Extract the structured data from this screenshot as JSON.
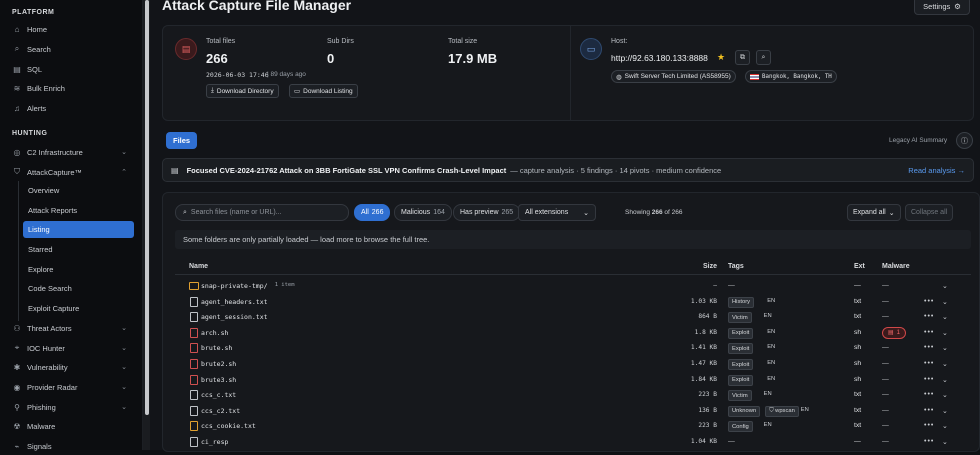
{
  "sidebar": {
    "platform_label": "PLATFORM",
    "platform_items": [
      {
        "label": "Home",
        "icon": "home-icon"
      },
      {
        "label": "Search",
        "icon": "search-icon"
      },
      {
        "label": "SQL",
        "icon": "database-icon"
      },
      {
        "label": "Bulk Enrich",
        "icon": "layers-icon"
      },
      {
        "label": "Alerts",
        "icon": "bell-icon"
      }
    ],
    "hunting_label": "HUNTING",
    "hunting_items": [
      {
        "label": "C2 Infrastructure",
        "icon": "target-icon"
      },
      {
        "label": "AttackCapture™",
        "icon": "shield-icon"
      }
    ],
    "attackcapture_sub": [
      "Overview",
      "Attack Reports",
      "Listing",
      "Starred",
      "Explore",
      "Code Search",
      "Exploit Capture"
    ],
    "active_sub": "Listing",
    "more_items": [
      {
        "label": "Threat Actors",
        "icon": "users-icon"
      },
      {
        "label": "IOC Hunter",
        "icon": "crosshair-icon"
      },
      {
        "label": "Vulnerability",
        "icon": "bug-icon"
      },
      {
        "label": "Provider Radar",
        "icon": "radar-icon"
      },
      {
        "label": "Phishing",
        "icon": "hook-icon"
      },
      {
        "label": "Malware",
        "icon": "virus-icon"
      },
      {
        "label": "Signals",
        "icon": "signal-icon"
      }
    ]
  },
  "page": {
    "title": "Attack Capture File Manager",
    "settings_label": "Settings"
  },
  "summary": {
    "total_files_label": "Total files",
    "total_files": "266",
    "subdirs_label": "Sub Dirs",
    "subdirs": "0",
    "total_size_label": "Total size",
    "total_size": "17.9 MB",
    "timestamp": "2026-06-03 17:46",
    "ago": "| 89 days ago",
    "download_directory": "Download Directory",
    "download_listing": "Download Listing",
    "host_label": "Host:",
    "host": "http://92.63.180.133:8888",
    "provider": "Swift Server Tech Limited (AS58955)",
    "location": "Bangkok, Bangkok, TH"
  },
  "tabs": {
    "files": "Files",
    "legacy": "Legacy AI Summary"
  },
  "banner": {
    "headline": "Focused CVE-2024-21762 Attack on 3BB FortiGate SSL VPN Confirms Crash-Level Impact",
    "meta": "— capture analysis · 5 findings · 14 pivots · medium confidence",
    "link": "Read analysis →"
  },
  "toolbar": {
    "search_placeholder": "Search files (name or URL)...",
    "filters": [
      {
        "label": "All",
        "count": "266"
      },
      {
        "label": "Malicious",
        "count": "164"
      },
      {
        "label": "Has preview",
        "count": "265"
      }
    ],
    "extensions": "All extensions",
    "showing": "Showing",
    "showing_count": "266",
    "showing_total": "of 266",
    "expand_all": "Expand all",
    "collapse_all": "Collapse all"
  },
  "notice": "Some folders are only partially loaded — load more to browse the full tree.",
  "table": {
    "headers": {
      "name": "Name",
      "size": "Size",
      "tags": "Tags",
      "ext": "Ext",
      "malware": "Malware"
    },
    "rows": [
      {
        "name": "snap-private-tmp/",
        "folder": true,
        "extra": "1 item",
        "size": "—",
        "tags": [],
        "lang": "",
        "ext": "—",
        "malware": "—"
      },
      {
        "name": "agent_headers.txt",
        "size": "1.03 KB",
        "tags": [
          "History"
        ],
        "lang": "EN",
        "ext": "txt",
        "malware": "—"
      },
      {
        "name": "agent_session.txt",
        "size": "864 B",
        "tags": [
          "Victim"
        ],
        "lang": "EN",
        "ext": "txt",
        "malware": "—"
      },
      {
        "name": "arch.sh",
        "size": "1.8 KB",
        "tags": [
          "Exploit"
        ],
        "lang": "EN",
        "ext": "sh",
        "malware": "1",
        "malbadge": true
      },
      {
        "name": "brute.sh",
        "size": "1.41 KB",
        "tags": [
          "Exploit"
        ],
        "lang": "EN",
        "ext": "sh",
        "malware": "—"
      },
      {
        "name": "brute2.sh",
        "size": "1.47 KB",
        "tags": [
          "Exploit"
        ],
        "lang": "EN",
        "ext": "sh",
        "malware": "—"
      },
      {
        "name": "brute3.sh",
        "size": "1.84 KB",
        "tags": [
          "Exploit"
        ],
        "lang": "EN",
        "ext": "sh",
        "malware": "—"
      },
      {
        "name": "ccs_c.txt",
        "size": "223 B",
        "tags": [
          "Victim"
        ],
        "lang": "EN",
        "ext": "txt",
        "malware": "—"
      },
      {
        "name": "ccs_c2.txt",
        "size": "136 B",
        "tags": [
          "Unknown",
          "wpscan"
        ],
        "lang": "EN",
        "ext": "txt",
        "malware": "—"
      },
      {
        "name": "ccs_cookie.txt",
        "size": "223 B",
        "tags": [
          "Config"
        ],
        "lang": "EN",
        "ext": "txt",
        "malware": "—"
      },
      {
        "name": "ci_resp",
        "size": "1.04 KB",
        "tags": [],
        "lang": "",
        "ext": "—",
        "malware": "—"
      }
    ]
  },
  "colors": {
    "accent": "#2f6fd1",
    "danger": "#d04848",
    "folder": "#e0a030"
  }
}
